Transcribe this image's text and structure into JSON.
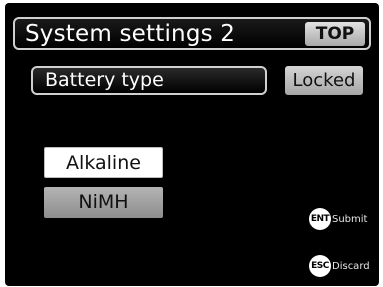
{
  "header": {
    "title": "System settings 2",
    "top_button": "TOP"
  },
  "setting": {
    "label": "Battery type",
    "status": "Locked"
  },
  "options": [
    {
      "label": "Alkaline",
      "selected": true
    },
    {
      "label": "NiMH",
      "selected": false
    }
  ],
  "keys": {
    "submit": {
      "key": "ENT",
      "label": "Submit"
    },
    "discard": {
      "key": "ESC",
      "label": "Discard"
    }
  },
  "colors": {
    "background": "#000000",
    "highlight": "#ffffff",
    "button_gray": "#a8a8a8"
  }
}
